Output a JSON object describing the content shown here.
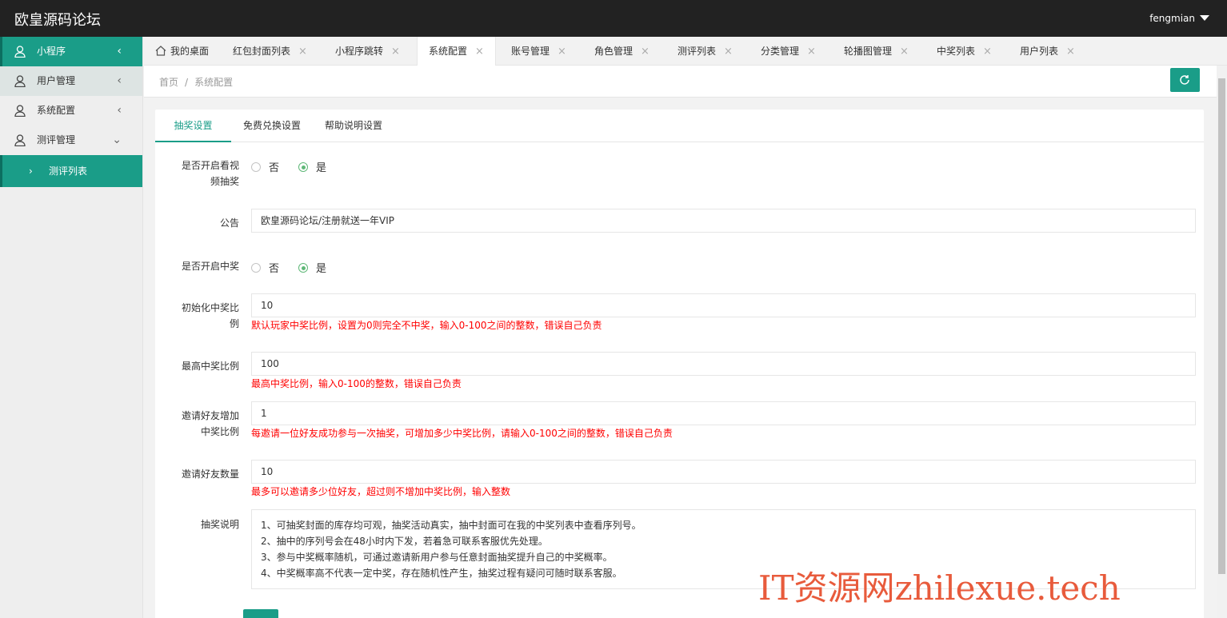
{
  "header": {
    "logo": "欧皇源码论坛",
    "username": "fengmian"
  },
  "sidebar": {
    "items": [
      {
        "label": "小程序",
        "icon": "user-icon",
        "arrow": "‹"
      },
      {
        "label": "用户管理",
        "icon": "user-icon",
        "arrow": "‹"
      },
      {
        "label": "系统配置",
        "icon": "user-icon",
        "arrow": "‹"
      },
      {
        "label": "测评管理",
        "icon": "user-icon",
        "arrow": "⌄"
      }
    ],
    "child": {
      "label": "测评列表",
      "arrow": "›"
    }
  },
  "tabs": [
    {
      "label": "我的桌面"
    },
    {
      "label": "红包封面列表"
    },
    {
      "label": "小程序跳转"
    },
    {
      "label": "系统配置"
    },
    {
      "label": "账号管理"
    },
    {
      "label": "角色管理"
    },
    {
      "label": "测评列表"
    },
    {
      "label": "分类管理"
    },
    {
      "label": "轮播图管理"
    },
    {
      "label": "中奖列表"
    },
    {
      "label": "用户列表"
    }
  ],
  "tab_close": "×",
  "breadcrumb": {
    "home": "首页",
    "sep": "/",
    "current": "系统配置"
  },
  "card_tabs": [
    {
      "label": "抽奖设置"
    },
    {
      "label": "免费兑换设置"
    },
    {
      "label": "帮助说明设置"
    }
  ],
  "form": {
    "video_lottery": {
      "label_line1": "是否开启看视",
      "label_line2": "频抽奖",
      "no": "否",
      "yes": "是",
      "selected": "是"
    },
    "notice": {
      "label": "公告",
      "value": "欧皇源码论坛/注册就送一年VIP"
    },
    "win_enabled": {
      "label": "是否开启中奖",
      "no": "否",
      "yes": "是",
      "selected": "是"
    },
    "init_ratio": {
      "label_line1": "初始化中奖比",
      "label_line2": "例",
      "value": "10",
      "hint": "默认玩家中奖比例，设置为0则完全不中奖，输入0-100之间的整数，错误自己负责"
    },
    "max_ratio": {
      "label": "最高中奖比例",
      "value": "100",
      "hint": "最高中奖比例，输入0-100的整数，错误自己负责"
    },
    "invite_ratio": {
      "label_line1": "邀请好友增加",
      "label_line2": "中奖比例",
      "value": "1",
      "hint": "每邀请一位好友成功参与一次抽奖，可增加多少中奖比例，请输入0-100之间的整数，错误自己负责"
    },
    "invite_count": {
      "label": "邀请好友数量",
      "value": "10",
      "hint": "最多可以邀请多少位好友，超过则不增加中奖比例，输入整数"
    },
    "lottery_desc": {
      "label": "抽奖说明",
      "lines": [
        "1、可抽奖封面的库存均可观，抽奖活动真实，抽中封面可在我的中奖列表中查看序列号。",
        "2、抽中的序列号会在48小时内下发，若着急可联系客服优先处理。",
        "3、参与中奖概率随机，可通过邀请新用户参与任意封面抽奖提升自己的中奖概率。",
        "4、中奖概率高不代表一定中奖，存在随机性产生，抽奖过程有疑问可随时联系客服。"
      ]
    }
  },
  "watermark": "IT资源网zhilexue.tech",
  "colors": {
    "accent": "#1a9d88",
    "header_bg": "#222222",
    "hint": "#ff0000",
    "radio_on": "#5fb878"
  }
}
